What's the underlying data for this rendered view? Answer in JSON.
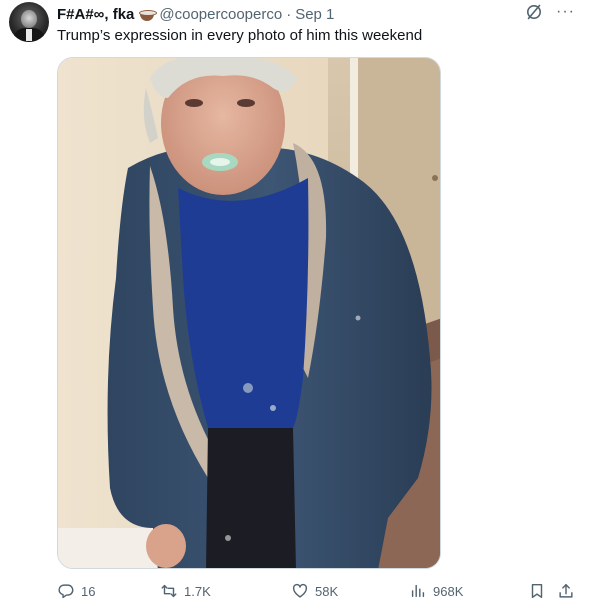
{
  "tweet": {
    "author": {
      "display_name": "F#A#∞, fka",
      "name_emoji": "coffee-cup-emoji",
      "handle": "@coopercooperco",
      "separator": "·",
      "date": "Sep 1"
    },
    "text": "Trump’s expression in every photo of him this weekend",
    "header_icons": [
      "grok-icon",
      "more-icon"
    ],
    "more_label": "···",
    "actions": {
      "replies": "16",
      "reposts": "1.7K",
      "likes": "58K",
      "views": "968K",
      "bookmark_icon": "bookmark-icon",
      "share_icon": "share-icon"
    },
    "colors": {
      "text_primary": "#0f1419",
      "text_secondary": "#536471",
      "border": "#cfd9de",
      "background": "#ffffff"
    }
  }
}
